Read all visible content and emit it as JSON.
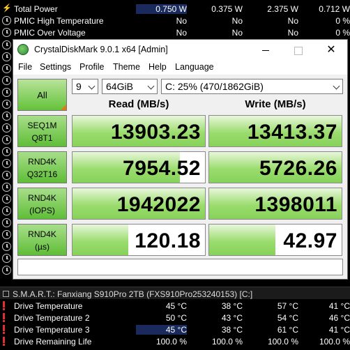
{
  "background_monitor": {
    "top_rows": [
      {
        "label": "Total Power",
        "icon": "lightning-icon",
        "values": [
          "0.750 W",
          "0.375 W",
          "2.375 W",
          "0.712 W"
        ]
      },
      {
        "label": "PMIC High Temperature",
        "icon": "clock-icon",
        "values": [
          "No",
          "No",
          "No",
          "0 %"
        ]
      },
      {
        "label": "PMIC Over Voltage",
        "icon": "clock-icon",
        "values": [
          "No",
          "No",
          "No",
          "0 %"
        ]
      }
    ],
    "smart_header": "S.M.A.R.T.: Fanxiang S910Pro 2TB (FXS910Pro253240153) [C:]",
    "smart_rows": [
      {
        "label": "Drive Temperature",
        "icon": "warning-icon",
        "values": [
          "45 °C",
          "38 °C",
          "57 °C",
          "41 °C"
        ]
      },
      {
        "label": "Drive Temperature 2",
        "icon": "warning-icon",
        "values": [
          "50 °C",
          "43 °C",
          "54 °C",
          "46 °C"
        ]
      },
      {
        "label": "Drive Temperature 3",
        "icon": "warning-icon",
        "values": [
          "45 °C",
          "38 °C",
          "61 °C",
          "41 °C"
        ]
      },
      {
        "label": "Drive Remaining Life",
        "icon": "warning-icon",
        "values": [
          "100.0 %",
          "100.0 %",
          "100.0 %",
          "100.0 %"
        ]
      }
    ]
  },
  "window": {
    "title": "CrystalDiskMark 9.0.1 x64 [Admin]",
    "menu": [
      "File",
      "Settings",
      "Profile",
      "Theme",
      "Help",
      "Language"
    ],
    "all_button": "All",
    "test_count": "9",
    "test_size": "64GiB",
    "drive": "C: 25% (470/1862GiB)",
    "read_header": "Read (MB/s)",
    "write_header": "Write (MB/s)",
    "comment": "",
    "rows": [
      {
        "line1": "SEQ1M",
        "line2": "Q8T1",
        "read": "13903.23",
        "write": "13413.37",
        "read_fill": 1.0,
        "write_fill": 1.0
      },
      {
        "line1": "RND4K",
        "line2": "Q32T16",
        "read": "7954.52",
        "write": "5726.26",
        "read_fill": 0.81,
        "write_fill": 1.0
      },
      {
        "line1": "RND4K",
        "line2": "(IOPS)",
        "read": "1942022",
        "write": "1398011",
        "read_fill": 1.0,
        "write_fill": 1.0
      },
      {
        "line1": "RND4K",
        "line2": "(µs)",
        "read": "120.18",
        "write": "42.97",
        "read_fill": 0.42,
        "write_fill": 0.5
      }
    ]
  }
}
